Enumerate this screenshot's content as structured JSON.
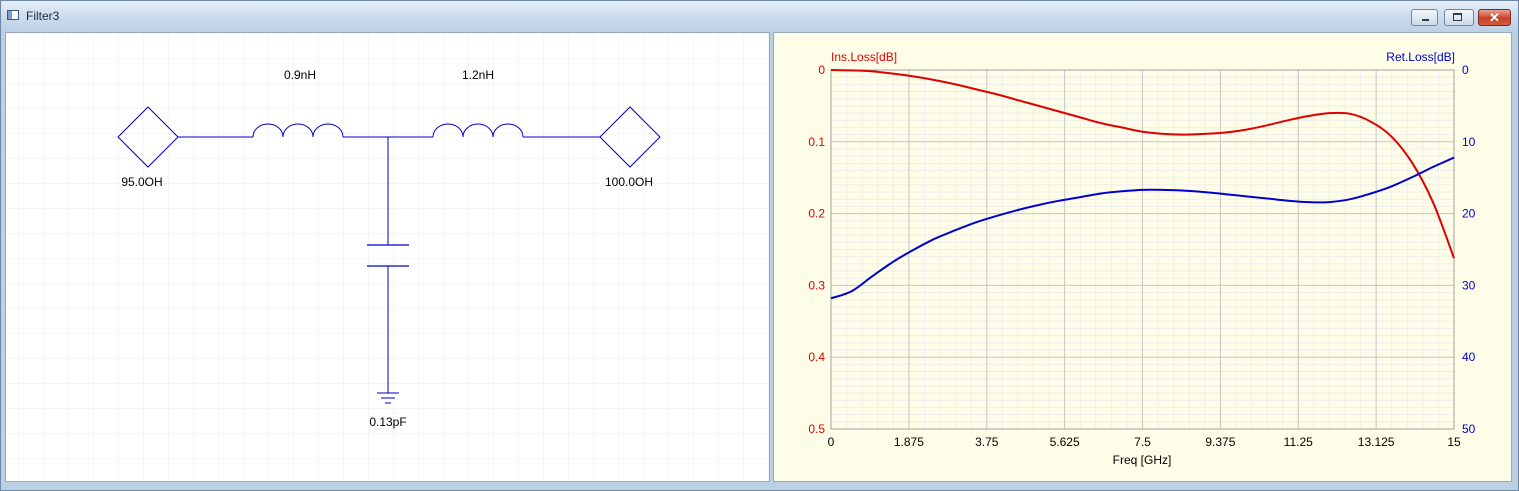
{
  "window": {
    "title": "Filter3",
    "buttons": {
      "minimize": "minimize",
      "maximize": "maximize",
      "close": "✕"
    }
  },
  "schematic": {
    "inductor1": "0.9nH",
    "inductor2": "1.2nH",
    "capacitor": "0.13pF",
    "source_port": "95.0OH",
    "load_port": "100.0OH",
    "wire_color": "#0000c0"
  },
  "chart_data": {
    "type": "line",
    "xlabel": "Freq [GHz]",
    "x_ticks": [
      "0",
      "1.875",
      "3.75",
      "5.625",
      "7.5",
      "9.375",
      "11.25",
      "13.125",
      "15"
    ],
    "xlim": [
      0,
      15
    ],
    "left_axis": {
      "label": "Ins.Loss[dB]",
      "ticks": [
        "0",
        "0.1",
        "0.2",
        "0.3",
        "0.4",
        "0.5"
      ],
      "lim": [
        0,
        0.5
      ],
      "inverted": true,
      "color": "#e00000"
    },
    "right_axis": {
      "label": "Ret.Loss[dB]",
      "ticks": [
        "0",
        "10",
        "20",
        "30",
        "40",
        "50"
      ],
      "lim": [
        0,
        50
      ],
      "inverted": true,
      "color": "#0000d0"
    },
    "grid": true,
    "series": [
      {
        "axis": "left",
        "color": "#e00000",
        "x": [
          0,
          0.5,
          1,
          1.5,
          2,
          2.5,
          3,
          3.5,
          4,
          4.5,
          5,
          5.5,
          6,
          6.5,
          7,
          7.5,
          8,
          8.5,
          9,
          9.5,
          10,
          10.5,
          11,
          11.5,
          12,
          12.5,
          13,
          13.5,
          14,
          14.5,
          15
        ],
        "y": [
          0.0,
          0.0005,
          0.002,
          0.005,
          0.009,
          0.014,
          0.02,
          0.027,
          0.034,
          0.042,
          0.05,
          0.058,
          0.066,
          0.074,
          0.08,
          0.086,
          0.089,
          0.09,
          0.089,
          0.087,
          0.083,
          0.077,
          0.07,
          0.064,
          0.06,
          0.061,
          0.072,
          0.093,
          0.13,
          0.185,
          0.262
        ]
      },
      {
        "axis": "right",
        "color": "#0000d0",
        "x": [
          0,
          0.5,
          1,
          1.5,
          2,
          2.5,
          3,
          3.5,
          4,
          4.5,
          5,
          5.5,
          6,
          6.5,
          7,
          7.5,
          8,
          8.5,
          9,
          9.5,
          10,
          10.5,
          11,
          11.5,
          12,
          12.5,
          13,
          13.5,
          14,
          14.5,
          15
        ],
        "y": [
          31.8,
          30.8,
          28.7,
          26.7,
          25.0,
          23.5,
          22.3,
          21.2,
          20.3,
          19.5,
          18.8,
          18.2,
          17.7,
          17.2,
          16.9,
          16.7,
          16.7,
          16.8,
          17.0,
          17.3,
          17.6,
          17.9,
          18.2,
          18.4,
          18.4,
          18.0,
          17.2,
          16.2,
          14.9,
          13.5,
          12.2
        ]
      }
    ]
  }
}
